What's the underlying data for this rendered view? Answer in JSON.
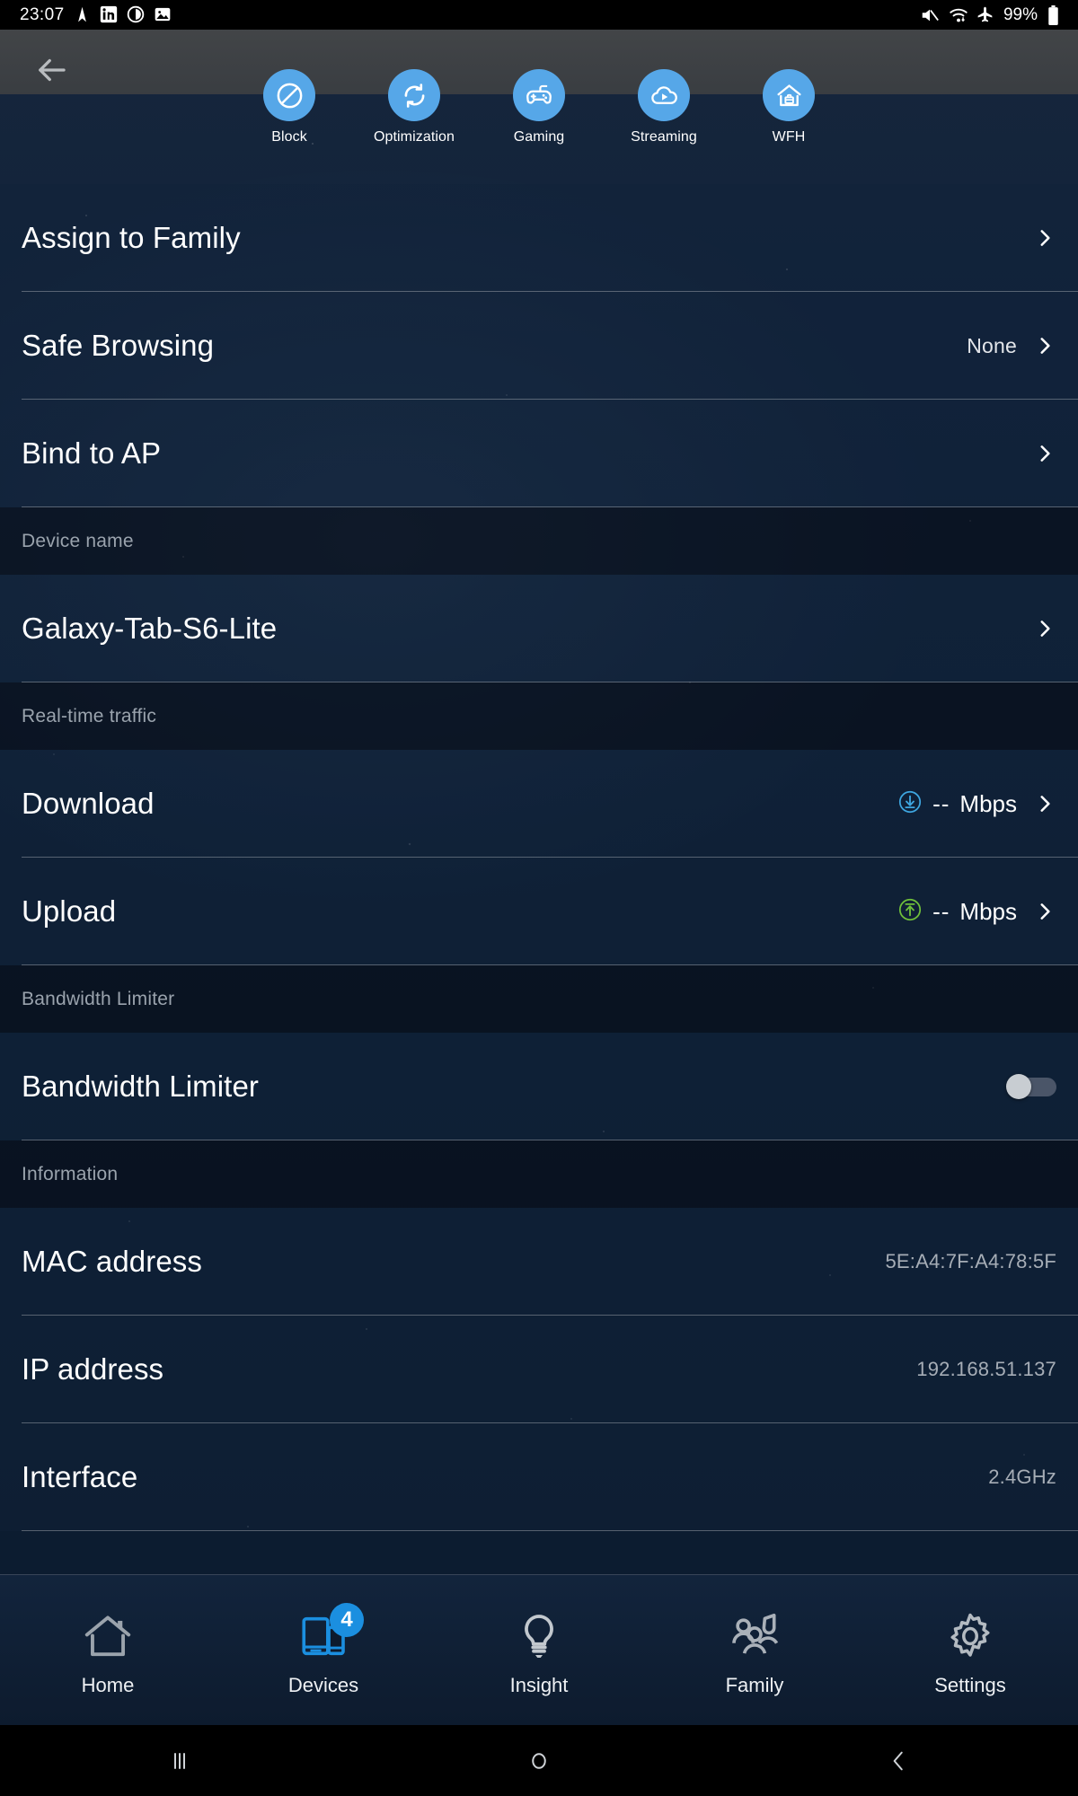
{
  "status_bar": {
    "clock": "23:07",
    "left_icons": [
      "navigation-icon",
      "linkedin-icon",
      "clock-alarm-icon",
      "gallery-icon"
    ],
    "right_icons": [
      "mute-icon",
      "wifi-icon",
      "airplane-mode-icon"
    ],
    "battery_percent": "99%"
  },
  "header": {
    "back_icon": "back-arrow-icon"
  },
  "quick_actions": [
    {
      "label": "Block",
      "icon": "block-icon"
    },
    {
      "label": "Optimization",
      "icon": "refresh-sync-icon"
    },
    {
      "label": "Gaming",
      "icon": "gamepad-icon"
    },
    {
      "label": "Streaming",
      "icon": "cloud-play-icon"
    },
    {
      "label": "WFH",
      "icon": "home-briefcase-icon"
    }
  ],
  "rows": {
    "assign_to_family": {
      "title": "Assign to Family",
      "value": ""
    },
    "safe_browsing": {
      "title": "Safe Browsing",
      "value": "None"
    },
    "bind_to_ap": {
      "title": "Bind to AP",
      "value": ""
    },
    "device_name": {
      "title": "Galaxy-Tab-S6-Lite"
    },
    "download": {
      "title": "Download",
      "number": "--",
      "unit": "Mbps"
    },
    "upload": {
      "title": "Upload",
      "number": "--",
      "unit": "Mbps"
    },
    "bandwidth_limiter": {
      "title": "Bandwidth Limiter",
      "state": "off"
    },
    "mac_address": {
      "title": "MAC address",
      "value": "5E:A4:7F:A4:78:5F"
    },
    "ip_address": {
      "title": "IP address",
      "value": "192.168.51.137"
    },
    "interface": {
      "title": "Interface",
      "value": "2.4GHz"
    }
  },
  "sections": {
    "device_name": "Device name",
    "realtime_traffic": "Real-time traffic",
    "bandwidth_limiter": "Bandwidth Limiter",
    "information": "Information"
  },
  "bottom_nav": [
    {
      "label": "Home",
      "icon": "home-icon",
      "badge": ""
    },
    {
      "label": "Devices",
      "icon": "devices-icon",
      "badge": "4"
    },
    {
      "label": "Insight",
      "icon": "bulb-icon",
      "badge": ""
    },
    {
      "label": "Family",
      "icon": "family-icon",
      "badge": ""
    },
    {
      "label": "Settings",
      "icon": "gear-icon",
      "badge": ""
    }
  ],
  "android_nav": [
    {
      "label": "recents-icon"
    },
    {
      "label": "home-circle-icon"
    },
    {
      "label": "back-chevron-icon"
    }
  ],
  "colors": {
    "accent_blue": "#56a7e8",
    "badge_blue": "#1b8fe0",
    "download_blue": "#3ea6e0",
    "upload_green": "#6fbf3a",
    "row_text": "#ffffff",
    "section_text": "#9aa3ad"
  }
}
